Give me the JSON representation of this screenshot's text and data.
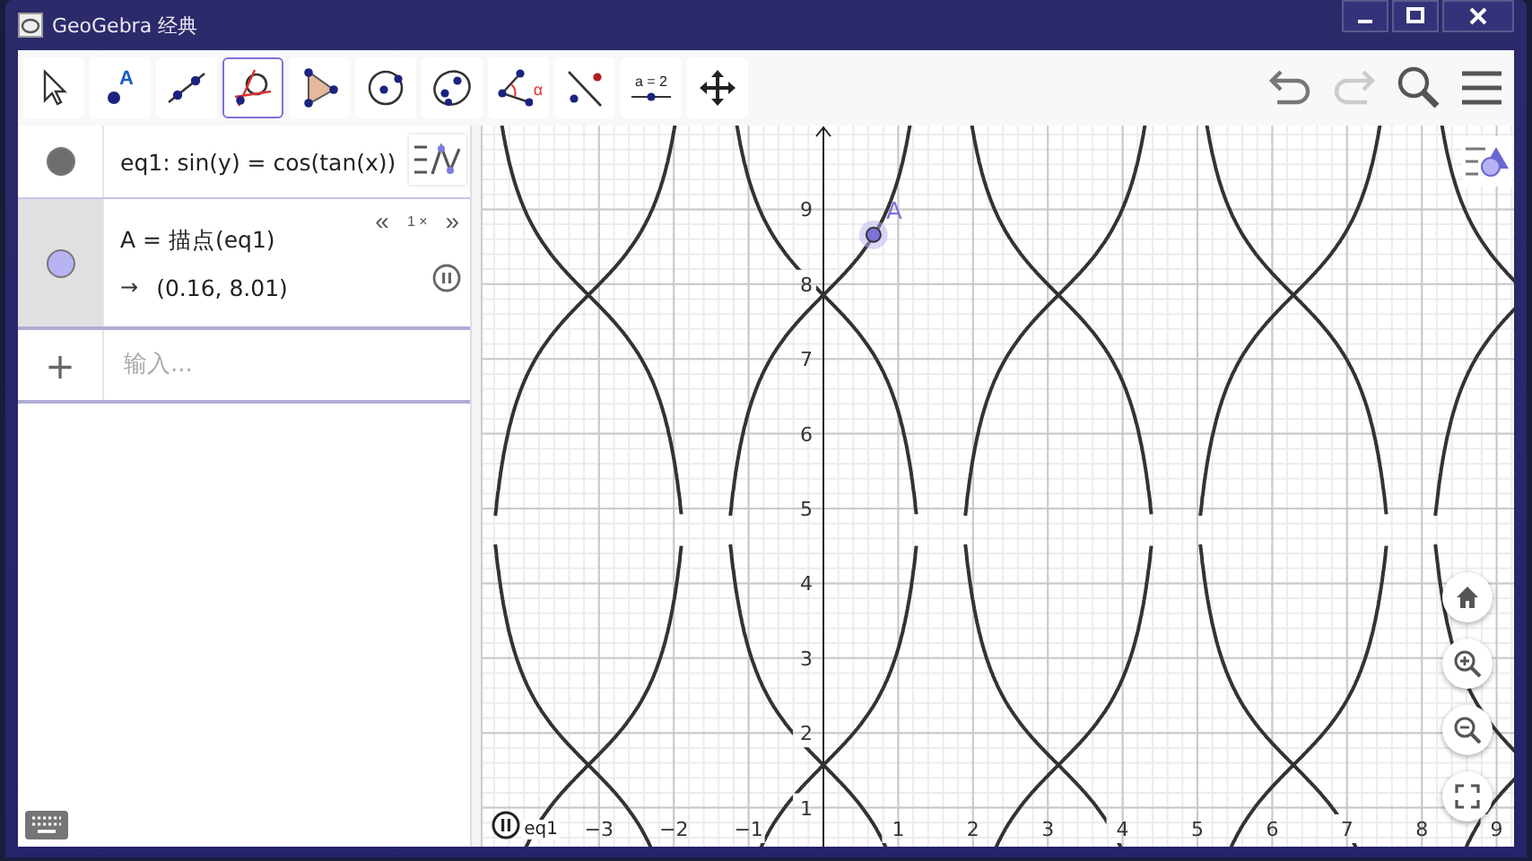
{
  "window": {
    "title": "GeoGebra 经典"
  },
  "toolbar": {
    "tools": [
      {
        "kind": "move",
        "selected": false
      },
      {
        "kind": "point",
        "selected": false,
        "label": "A"
      },
      {
        "kind": "line",
        "selected": false
      },
      {
        "kind": "tangent",
        "selected": true
      },
      {
        "kind": "polygon",
        "selected": false
      },
      {
        "kind": "circle",
        "selected": false
      },
      {
        "kind": "conic",
        "selected": false
      },
      {
        "kind": "angle",
        "selected": false,
        "label": "α"
      },
      {
        "kind": "reflect",
        "selected": false
      },
      {
        "kind": "slider",
        "selected": false,
        "label": "a = 2"
      },
      {
        "kind": "pan",
        "selected": false
      }
    ]
  },
  "algebra": {
    "items": [
      {
        "kind": "equation",
        "color": "#6e6e6e",
        "selected": false,
        "text": "eq1: sin(y) = cos(tan(x))"
      },
      {
        "kind": "point",
        "color": "#b7b2f2",
        "selected": true,
        "text": "A = 描点(eq1)",
        "arrow": "→",
        "output": "(0.16, 8.01)",
        "animation": {
          "slower": "«",
          "speed": "1 ×",
          "faster": "»",
          "playing": true
        }
      }
    ],
    "input": {
      "add": "+",
      "placeholder": "输入..."
    }
  },
  "graphics": {
    "x_ticks": [
      "−3",
      "−2",
      "−1",
      "1",
      "2",
      "3",
      "4",
      "5",
      "6",
      "7",
      "8",
      "9"
    ],
    "y_ticks": [
      "9",
      "8",
      "7",
      "6",
      "5",
      "4",
      "3",
      "2",
      "1"
    ],
    "point_label": "A",
    "curve_label": "eq1"
  }
}
